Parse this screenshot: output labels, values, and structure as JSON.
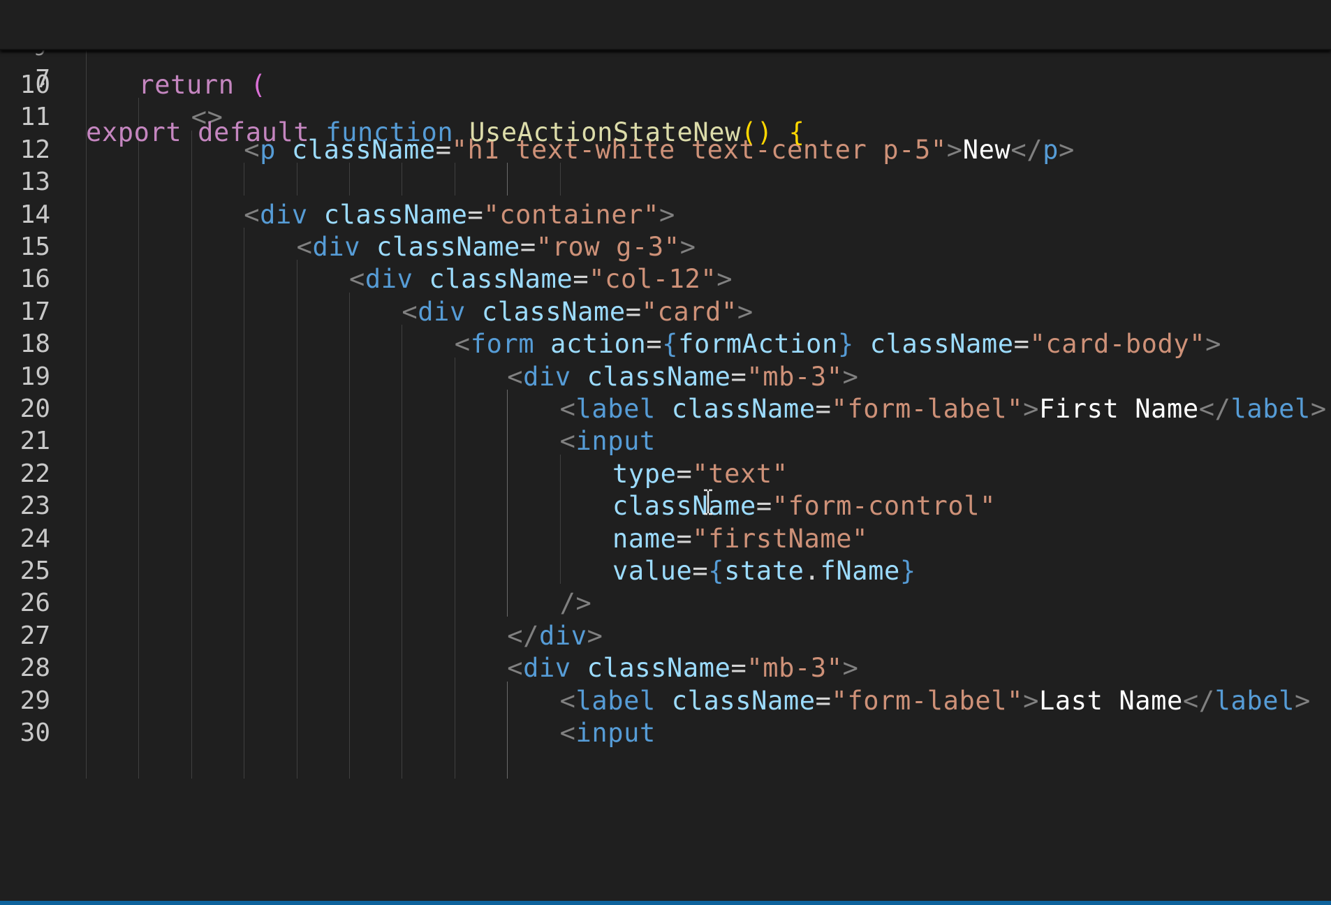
{
  "editor": {
    "theme": "dark",
    "background": "#1f1f1f",
    "cursor_icon": "text-cursor-icon",
    "sticky_line": {
      "number": "7",
      "tokens": [
        {
          "t": "export",
          "c": "kw"
        },
        {
          "t": " ",
          "c": "op"
        },
        {
          "t": "default",
          "c": "kw"
        },
        {
          "t": " ",
          "c": "op"
        },
        {
          "t": "function",
          "c": "sto"
        },
        {
          "t": " ",
          "c": "op"
        },
        {
          "t": "UseActionStateNew",
          "c": "fn"
        },
        {
          "t": "()",
          "c": "p1"
        },
        {
          "t": " ",
          "c": "op"
        },
        {
          "t": "{",
          "c": "p1"
        }
      ]
    },
    "lines": [
      {
        "number": "10",
        "indent": 1,
        "tokens": [
          {
            "t": "return",
            "c": "kw"
          },
          {
            "t": " ",
            "c": "op"
          },
          {
            "t": "(",
            "c": "p2"
          }
        ]
      },
      {
        "number": "11",
        "indent": 2,
        "tokens": [
          {
            "t": "<>",
            "c": "punc"
          }
        ]
      },
      {
        "number": "12",
        "indent": 3,
        "tokens": [
          {
            "t": "<",
            "c": "punc"
          },
          {
            "t": "p",
            "c": "tag"
          },
          {
            "t": " ",
            "c": "op"
          },
          {
            "t": "className",
            "c": "attr"
          },
          {
            "t": "=",
            "c": "op"
          },
          {
            "t": "\"h1 text-white text-center p-5\"",
            "c": "str"
          },
          {
            "t": ">",
            "c": "punc"
          },
          {
            "t": "New",
            "c": "txt"
          },
          {
            "t": "</",
            "c": "punc"
          },
          {
            "t": "p",
            "c": "tag"
          },
          {
            "t": ">",
            "c": "punc"
          }
        ]
      },
      {
        "number": "13",
        "indent": 0,
        "tokens": []
      },
      {
        "number": "14",
        "indent": 3,
        "tokens": [
          {
            "t": "<",
            "c": "punc"
          },
          {
            "t": "div",
            "c": "tag"
          },
          {
            "t": " ",
            "c": "op"
          },
          {
            "t": "className",
            "c": "attr"
          },
          {
            "t": "=",
            "c": "op"
          },
          {
            "t": "\"container\"",
            "c": "str"
          },
          {
            "t": ">",
            "c": "punc"
          }
        ]
      },
      {
        "number": "15",
        "indent": 4,
        "tokens": [
          {
            "t": "<",
            "c": "punc"
          },
          {
            "t": "div",
            "c": "tag"
          },
          {
            "t": " ",
            "c": "op"
          },
          {
            "t": "className",
            "c": "attr"
          },
          {
            "t": "=",
            "c": "op"
          },
          {
            "t": "\"row g-3\"",
            "c": "str"
          },
          {
            "t": ">",
            "c": "punc"
          }
        ]
      },
      {
        "number": "16",
        "indent": 5,
        "tokens": [
          {
            "t": "<",
            "c": "punc"
          },
          {
            "t": "div",
            "c": "tag"
          },
          {
            "t": " ",
            "c": "op"
          },
          {
            "t": "className",
            "c": "attr"
          },
          {
            "t": "=",
            "c": "op"
          },
          {
            "t": "\"col-12\"",
            "c": "str"
          },
          {
            "t": ">",
            "c": "punc"
          }
        ]
      },
      {
        "number": "17",
        "indent": 6,
        "tokens": [
          {
            "t": "<",
            "c": "punc"
          },
          {
            "t": "div",
            "c": "tag"
          },
          {
            "t": " ",
            "c": "op"
          },
          {
            "t": "className",
            "c": "attr"
          },
          {
            "t": "=",
            "c": "op"
          },
          {
            "t": "\"card\"",
            "c": "str"
          },
          {
            "t": ">",
            "c": "punc"
          }
        ]
      },
      {
        "number": "18",
        "indent": 7,
        "tokens": [
          {
            "t": "<",
            "c": "punc"
          },
          {
            "t": "form",
            "c": "tag"
          },
          {
            "t": " ",
            "c": "op"
          },
          {
            "t": "action",
            "c": "attr"
          },
          {
            "t": "=",
            "c": "op"
          },
          {
            "t": "{",
            "c": "brace"
          },
          {
            "t": "formAction",
            "c": "var"
          },
          {
            "t": "}",
            "c": "brace"
          },
          {
            "t": " ",
            "c": "op"
          },
          {
            "t": "className",
            "c": "attr"
          },
          {
            "t": "=",
            "c": "op"
          },
          {
            "t": "\"card-body\"",
            "c": "str"
          },
          {
            "t": ">",
            "c": "punc"
          }
        ]
      },
      {
        "number": "19",
        "indent": 8,
        "tokens": [
          {
            "t": "<",
            "c": "punc"
          },
          {
            "t": "div",
            "c": "tag"
          },
          {
            "t": " ",
            "c": "op"
          },
          {
            "t": "className",
            "c": "attr"
          },
          {
            "t": "=",
            "c": "op"
          },
          {
            "t": "\"mb-3\"",
            "c": "str"
          },
          {
            "t": ">",
            "c": "punc"
          }
        ]
      },
      {
        "number": "20",
        "indent": 9,
        "tokens": [
          {
            "t": "<",
            "c": "punc"
          },
          {
            "t": "label",
            "c": "tag"
          },
          {
            "t": " ",
            "c": "op"
          },
          {
            "t": "className",
            "c": "attr"
          },
          {
            "t": "=",
            "c": "op"
          },
          {
            "t": "\"form-label\"",
            "c": "str"
          },
          {
            "t": ">",
            "c": "punc"
          },
          {
            "t": "First Name",
            "c": "txt"
          },
          {
            "t": "</",
            "c": "punc"
          },
          {
            "t": "label",
            "c": "tag"
          },
          {
            "t": ">",
            "c": "punc"
          }
        ]
      },
      {
        "number": "21",
        "indent": 9,
        "tokens": [
          {
            "t": "<",
            "c": "punc"
          },
          {
            "t": "input",
            "c": "tag"
          }
        ]
      },
      {
        "number": "22",
        "indent": 10,
        "tokens": [
          {
            "t": "type",
            "c": "attr"
          },
          {
            "t": "=",
            "c": "op"
          },
          {
            "t": "\"text\"",
            "c": "str"
          }
        ]
      },
      {
        "number": "23",
        "indent": 10,
        "tokens": [
          {
            "t": "className",
            "c": "attr"
          },
          {
            "t": "=",
            "c": "op"
          },
          {
            "t": "\"form-control\"",
            "c": "str"
          }
        ]
      },
      {
        "number": "24",
        "indent": 10,
        "tokens": [
          {
            "t": "name",
            "c": "attr"
          },
          {
            "t": "=",
            "c": "op"
          },
          {
            "t": "\"firstName\"",
            "c": "str"
          }
        ]
      },
      {
        "number": "25",
        "indent": 10,
        "tokens": [
          {
            "t": "value",
            "c": "attr"
          },
          {
            "t": "=",
            "c": "op"
          },
          {
            "t": "{",
            "c": "brace"
          },
          {
            "t": "state",
            "c": "var"
          },
          {
            "t": ".",
            "c": "op"
          },
          {
            "t": "fName",
            "c": "var"
          },
          {
            "t": "}",
            "c": "brace"
          }
        ]
      },
      {
        "number": "26",
        "indent": 9,
        "tokens": [
          {
            "t": "/>",
            "c": "punc"
          }
        ]
      },
      {
        "number": "27",
        "indent": 8,
        "tokens": [
          {
            "t": "</",
            "c": "punc"
          },
          {
            "t": "div",
            "c": "tag"
          },
          {
            "t": ">",
            "c": "punc"
          }
        ]
      },
      {
        "number": "28",
        "indent": 8,
        "tokens": [
          {
            "t": "<",
            "c": "punc"
          },
          {
            "t": "div",
            "c": "tag"
          },
          {
            "t": " ",
            "c": "op"
          },
          {
            "t": "className",
            "c": "attr"
          },
          {
            "t": "=",
            "c": "op"
          },
          {
            "t": "\"mb-3\"",
            "c": "str"
          },
          {
            "t": ">",
            "c": "punc"
          }
        ]
      },
      {
        "number": "29",
        "indent": 9,
        "tokens": [
          {
            "t": "<",
            "c": "punc"
          },
          {
            "t": "label",
            "c": "tag"
          },
          {
            "t": " ",
            "c": "op"
          },
          {
            "t": "className",
            "c": "attr"
          },
          {
            "t": "=",
            "c": "op"
          },
          {
            "t": "\"form-label\"",
            "c": "str"
          },
          {
            "t": ">",
            "c": "punc"
          },
          {
            "t": "Last Name",
            "c": "txt"
          },
          {
            "t": "</",
            "c": "punc"
          },
          {
            "t": "label",
            "c": "tag"
          },
          {
            "t": ">",
            "c": "punc"
          }
        ]
      },
      {
        "number": "30",
        "indent": 9,
        "tokens": [
          {
            "t": "<",
            "c": "punc"
          },
          {
            "t": "input",
            "c": "tag"
          }
        ]
      }
    ]
  }
}
